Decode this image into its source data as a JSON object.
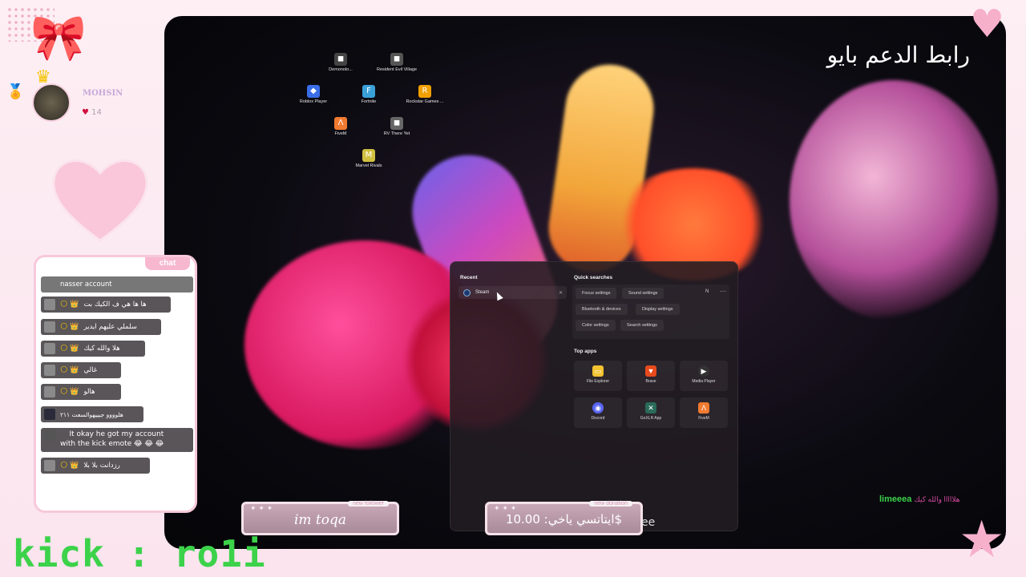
{
  "stream": {
    "title": "رابط الدعم بايو",
    "channel_label": "kick : ro1i"
  },
  "subscriber": {
    "name": "MOHSIN",
    "count": "14"
  },
  "chat": {
    "tab_label": "chat",
    "messages": [
      {
        "text": "nasser account",
        "emoji": ""
      },
      {
        "text": "ها ها هي ف الكيك بت",
        "emoji": "🌕 👑"
      },
      {
        "text": "سلملي عليهم ايدير",
        "emoji": "🌕 👑"
      },
      {
        "text": "هلا والله كيك",
        "emoji": "🌕 👑"
      },
      {
        "text": "غالي",
        "emoji": "🌕 👑"
      },
      {
        "text": "هالو",
        "emoji": "🌕 👑"
      },
      {
        "text": "هلوووو جيييهوالسعت ٢١١",
        "emoji": ""
      },
      {
        "text": "It okay he got my account\nwith the kick emote 😂 😂 😂",
        "emoji": ""
      },
      {
        "text": "رزدانت بلا بلا",
        "emoji": "🌕 👑"
      }
    ]
  },
  "desktop_icons": [
    {
      "label": "Demonolo...",
      "icon": "demonologist-icon",
      "color": "#444444"
    },
    {
      "label": "Resident Evil Village",
      "icon": "resident-evil-icon",
      "color": "#555555"
    },
    {
      "label": "Roblox Player",
      "icon": "roblox-icon",
      "color": "#3a6ee8"
    },
    {
      "label": "Fortnite",
      "icon": "fortnite-icon",
      "color": "#39a0d8"
    },
    {
      "label": "Rockstar Games ...",
      "icon": "rockstar-icon",
      "color": "#f0a000"
    },
    {
      "label": "FiveM",
      "icon": "fivem-icon",
      "color": "#f07a30"
    },
    {
      "label": "RV There Yet",
      "icon": "rv-there-yet-icon",
      "color": "#666666"
    },
    {
      "label": "Marvel Rivals",
      "icon": "marvel-rivals-icon",
      "color": "#d0c040"
    }
  ],
  "start_menu": {
    "recent_heading": "Recent",
    "recent_items": [
      {
        "label": "Steam",
        "icon": "steam-icon"
      }
    ],
    "quick_heading": "Quick searches",
    "user_initial": "N",
    "more": "···",
    "quick_searches": [
      "Focus settings",
      "Sound settings",
      "Bluetooth & devices",
      "Display settings",
      "Color settings",
      "Search settings"
    ],
    "top_apps_heading": "Top apps",
    "top_apps": [
      {
        "label": "File Explorer",
        "icon": "folder-icon",
        "color": "#f2c230"
      },
      {
        "label": "Brave",
        "icon": "brave-icon",
        "color": "#e84a1c"
      },
      {
        "label": "Media Player",
        "icon": "media-player-icon",
        "color": "#333333"
      },
      {
        "label": "Discord",
        "icon": "discord-icon",
        "color": "#5865f2"
      },
      {
        "label": "GoXLR App",
        "icon": "goxlr-icon",
        "color": "#2a6a5a"
      },
      {
        "label": "FiveM",
        "icon": "fivem-icon",
        "color": "#f07a30"
      }
    ]
  },
  "alerts": {
    "follower_tag": "new follower",
    "follower_name": "im toqa",
    "donation_tag": "new donation",
    "donation_text": "ايتاتسي ياخي: 10.00$",
    "donation_extra": "ee"
  },
  "overlay_message": {
    "user": "limeeea",
    "text": "هلااااا والله كيك"
  }
}
